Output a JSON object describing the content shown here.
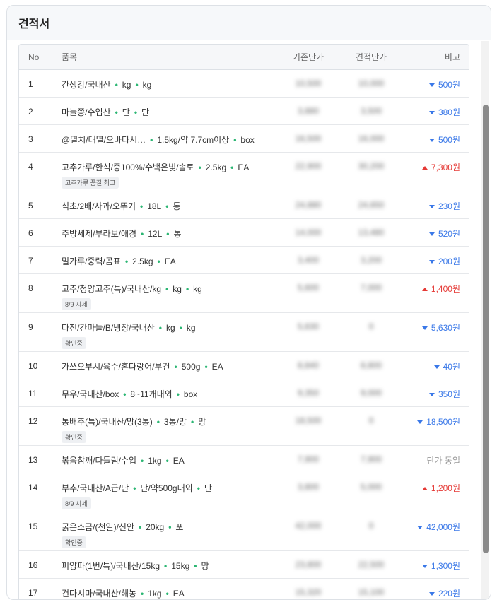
{
  "panel": {
    "title": "견적서"
  },
  "columns": {
    "no": "No",
    "item": "품목",
    "base_price": "기존단가",
    "est_price": "견적단가",
    "note": "비고"
  },
  "rows": [
    {
      "no": "1",
      "name": "간생강/국내산",
      "spec": "kg",
      "unit": "kg",
      "tag": "",
      "base": "10,500",
      "est": "10,000",
      "note": "500원",
      "dir": "down"
    },
    {
      "no": "2",
      "name": "마늘쫑/수입산",
      "spec": "단",
      "unit": "단",
      "tag": "",
      "base": "3,880",
      "est": "3,500",
      "note": "380원",
      "dir": "down"
    },
    {
      "no": "3",
      "name": "@멸치/대멸/오바다시…",
      "spec": "1.5kg/약 7.7cm이상",
      "unit": "box",
      "tag": "",
      "base": "16,500",
      "est": "16,000",
      "note": "500원",
      "dir": "down"
    },
    {
      "no": "4",
      "name": "고추가루/한식/중100%/수백은빛/솔토",
      "spec": "2.5kg",
      "unit": "EA",
      "tag": "고추가루 품질 최고",
      "base": "22,900",
      "est": "30,200",
      "note": "7,300원",
      "dir": "up"
    },
    {
      "no": "5",
      "name": "식초/2배/사과/오뚜기",
      "spec": "18L",
      "unit": "통",
      "tag": "",
      "base": "24,880",
      "est": "24,650",
      "note": "230원",
      "dir": "down"
    },
    {
      "no": "6",
      "name": "주방세제/부라보/애경",
      "spec": "12L",
      "unit": "통",
      "tag": "",
      "base": "14,000",
      "est": "13,480",
      "note": "520원",
      "dir": "down"
    },
    {
      "no": "7",
      "name": "밀가루/중력/곰표",
      "spec": "2.5kg",
      "unit": "EA",
      "tag": "",
      "base": "3,400",
      "est": "3,200",
      "note": "200원",
      "dir": "down"
    },
    {
      "no": "8",
      "name": "고추/청양고추(특)/국내산/kg",
      "spec": "kg",
      "unit": "kg",
      "tag": "8/9 시세",
      "base": "5,600",
      "est": "7,000",
      "note": "1,400원",
      "dir": "up"
    },
    {
      "no": "9",
      "name": "다진/간마늘/B/냉장/국내산",
      "spec": "kg",
      "unit": "kg",
      "tag": "확인중",
      "base": "5,630",
      "est": "0",
      "note": "5,630원",
      "dir": "down"
    },
    {
      "no": "10",
      "name": "가쓰오부시/육수/혼다랑어/부건",
      "spec": "500g",
      "unit": "EA",
      "tag": "",
      "base": "8,840",
      "est": "8,800",
      "note": "40원",
      "dir": "down"
    },
    {
      "no": "11",
      "name": "무우/국내산/box",
      "spec": "8~11개내외",
      "unit": "box",
      "tag": "",
      "base": "9,350",
      "est": "9,000",
      "note": "350원",
      "dir": "down"
    },
    {
      "no": "12",
      "name": "통배추(특)/국내산/망(3통)",
      "spec": "3통/망",
      "unit": "망",
      "tag": "확인중",
      "base": "18,500",
      "est": "0",
      "note": "18,500원",
      "dir": "down"
    },
    {
      "no": "13",
      "name": "볶음참깨/다들림/수입",
      "spec": "1kg",
      "unit": "EA",
      "tag": "",
      "base": "7,900",
      "est": "7,900",
      "note": "단가 동일",
      "dir": "same"
    },
    {
      "no": "14",
      "name": "부추/국내산/A급/단",
      "spec": "단/약500g내외",
      "unit": "단",
      "tag": "8/9 시세",
      "base": "3,800",
      "est": "5,000",
      "note": "1,200원",
      "dir": "up"
    },
    {
      "no": "15",
      "name": "굵은소금/(천일)/신안",
      "spec": "20kg",
      "unit": "포",
      "tag": "확인중",
      "base": "42,000",
      "est": "0",
      "note": "42,000원",
      "dir": "down"
    },
    {
      "no": "16",
      "name": "피양파(1번/특)/국내산/15kg",
      "spec": "15kg",
      "unit": "망",
      "tag": "",
      "base": "23,800",
      "est": "22,500",
      "note": "1,300원",
      "dir": "down"
    },
    {
      "no": "17",
      "name": "건다시마/국내산/해농",
      "spec": "1kg",
      "unit": "EA",
      "tag": "",
      "base": "15,320",
      "est": "15,100",
      "note": "220원",
      "dir": "down"
    }
  ]
}
